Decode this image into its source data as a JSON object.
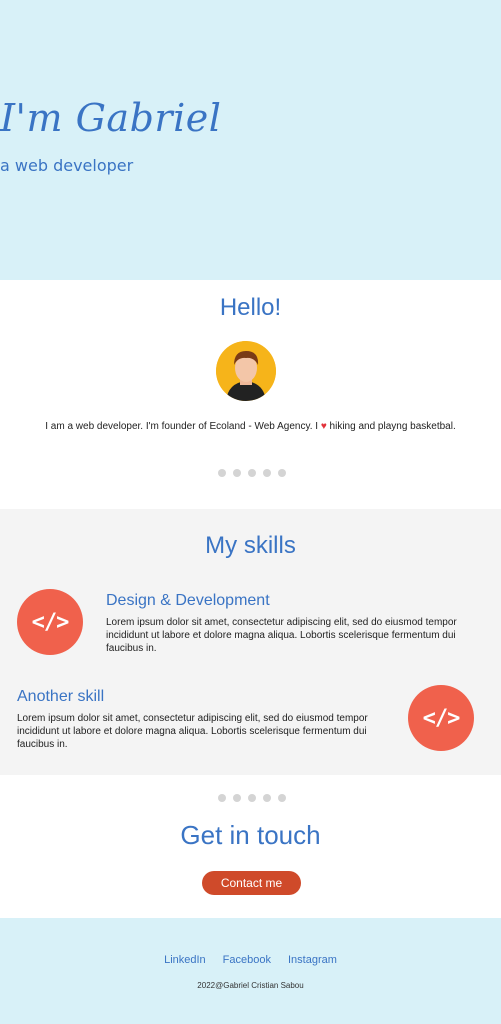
{
  "hero": {
    "title": "I'm Gabriel",
    "subtitle": "a web developer"
  },
  "hello": {
    "title": "Hello!",
    "intro_before": "I am a web developer. I'm founder of Ecoland  - Web Agency. I ",
    "heart": "♥",
    "intro_after": " hiking and playng basketbal."
  },
  "skills": {
    "title": "My skills",
    "items": [
      {
        "name": "Design & Development",
        "icon_text": "</>",
        "description": "Lorem ipsum dolor sit amet, consectetur adipiscing elit, sed do eiusmod tempor incididunt ut labore et dolore magna aliqua. Lobortis scelerisque fermentum dui faucibus in."
      },
      {
        "name": "Another skill",
        "icon_text": "</>",
        "description": "Lorem ipsum dolor sit amet, consectetur adipiscing elit, sed do eiusmod tempor incididunt ut labore et dolore magna aliqua. Lobortis scelerisque fermentum dui faucibus in."
      }
    ]
  },
  "contact": {
    "title": "Get in touch",
    "button_label": "Contact me"
  },
  "footer": {
    "links": [
      "LinkedIn",
      "Facebook",
      "Instagram"
    ],
    "copyright": "2022@Gabriel Cristian Sabou"
  },
  "colors": {
    "accent": "#3a74c4",
    "hero_bg": "#d8f1f8",
    "skill_icon": "#f0614c",
    "button": "#cf4a2a"
  },
  "icons": [
    "avatar-icon",
    "code-icon"
  ]
}
